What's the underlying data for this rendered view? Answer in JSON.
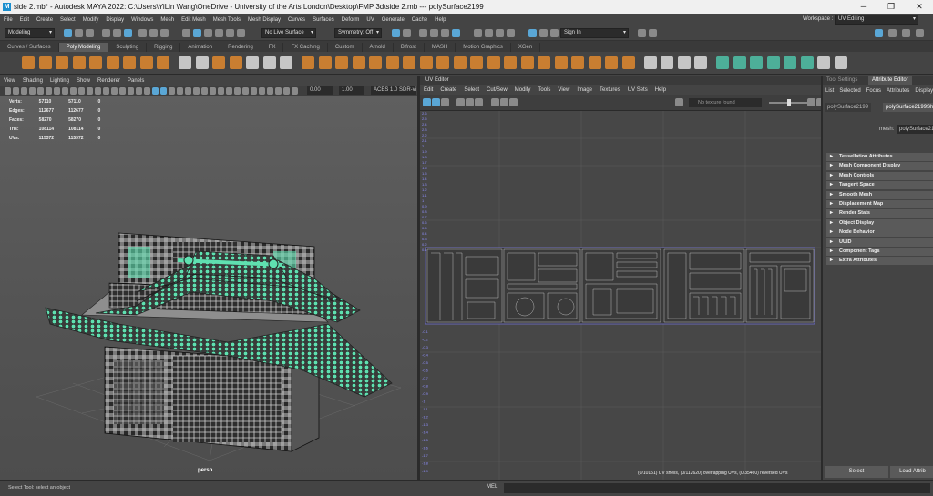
{
  "window": {
    "title": "side 2.mb* - Autodesk MAYA 2022: C:\\Users\\YiLin Wang\\OneDrive - University of the Arts London\\Desktop\\FMP 3d\\side 2.mb   ---   polySurface2199",
    "logo": "M",
    "minimize": "─",
    "maximize": "❐",
    "close": "✕"
  },
  "menubar": [
    "File",
    "Edit",
    "Create",
    "Select",
    "Modify",
    "Display",
    "Windows",
    "Mesh",
    "Edit Mesh",
    "Mesh Tools",
    "Mesh Display",
    "Curves",
    "Surfaces",
    "Deform",
    "UV",
    "Generate",
    "Cache",
    "Help"
  ],
  "workspace": {
    "label": "Workspace :",
    "value": "UV Editing"
  },
  "statusline": {
    "mode": "Modeling",
    "live": "No Live Surface",
    "symmetry": "Symmetry: Off",
    "signin": "Sign In"
  },
  "shelf_tabs": [
    "Curves / Surfaces",
    "Poly Modeling",
    "Sculpting",
    "Rigging",
    "Animation",
    "Rendering",
    "FX",
    "FX Caching",
    "Custom",
    "Arnold",
    "Bifrost",
    "MASH",
    "Motion Graphics",
    "XGen"
  ],
  "shelf_active": "Poly Modeling",
  "viewport": {
    "menu": [
      "View",
      "Shading",
      "Lighting",
      "Show",
      "Renderer",
      "Panels"
    ],
    "field1": "0.00",
    "field2": "1.00",
    "colorspace": "ACES 1.0 SDR-vi",
    "hud": [
      {
        "label": "Verts:",
        "a": "57110",
        "b": "57110",
        "c": "0"
      },
      {
        "label": "Edges:",
        "a": "112677",
        "b": "112677",
        "c": "0"
      },
      {
        "label": "Faces:",
        "a": "58270",
        "b": "58270",
        "c": "0"
      },
      {
        "label": "Tris:",
        "a": "108114",
        "b": "108114",
        "c": "0"
      },
      {
        "label": "UVs:",
        "a": "115372",
        "b": "115372",
        "c": "0"
      }
    ],
    "camera": "persp"
  },
  "uv_editor": {
    "title": "UV Editor",
    "menu": [
      "Edit",
      "Create",
      "Select",
      "Cut/Sew",
      "Modify",
      "Tools",
      "View",
      "Image",
      "Textures",
      "UV Sets",
      "Help"
    ],
    "texture": "No texture found",
    "ticks_top": [
      "2.6",
      "2.5",
      "2.4",
      "2.3",
      "2.2",
      "2.1",
      "2",
      "1.9",
      "1.8",
      "1.7",
      "1.6",
      "1.5",
      "1.4",
      "1.3",
      "1.2",
      "1.1",
      "1",
      "0.9",
      "0.8",
      "0.7",
      "0.6",
      "0.5",
      "0.4",
      "0.3",
      "0.2",
      "0.1"
    ],
    "ticks_bottom": [
      "-0.1",
      "-0.2",
      "-0.3",
      "-0.4",
      "-0.5",
      "-0.6",
      "-0.7",
      "-0.8",
      "-0.9",
      "-1",
      "-1.1",
      "-1.2",
      "-1.3",
      "-1.4",
      "-1.5",
      "-1.6",
      "-1.7",
      "-1.8",
      "-1.9"
    ],
    "status": "(0/10151) UV shells, (0/112620) overlapping UVs, (0/35460) reversed UVs"
  },
  "attribute_panel": {
    "tab_settings": "Tool Settings",
    "tab_editor": "Attribute Editor",
    "menu": [
      "List",
      "Selected",
      "Focus",
      "Attributes",
      "Display"
    ],
    "node_tab1": "polySurface2199",
    "node_tab2": "polySurface2199Sha",
    "mesh_label": "mesh:",
    "mesh_value": "polySurface2199",
    "sections": [
      "Tessellation Attributes",
      "Mesh Component Display",
      "Mesh Controls",
      "Tangent Space",
      "Smooth Mesh",
      "Displacement Map",
      "Render Stats",
      "Object Display",
      "Node Behavior",
      "UUID",
      "Component Tags",
      "Extra Attributes"
    ],
    "select_btn": "Select",
    "load_btn": "Load Attrib"
  },
  "helpline": {
    "text": "Select Tool: select an object",
    "mel": "MEL"
  },
  "colors": {
    "accent": "#5aa7d6",
    "tile_green": "#5fe0b0",
    "background": "#444444"
  }
}
